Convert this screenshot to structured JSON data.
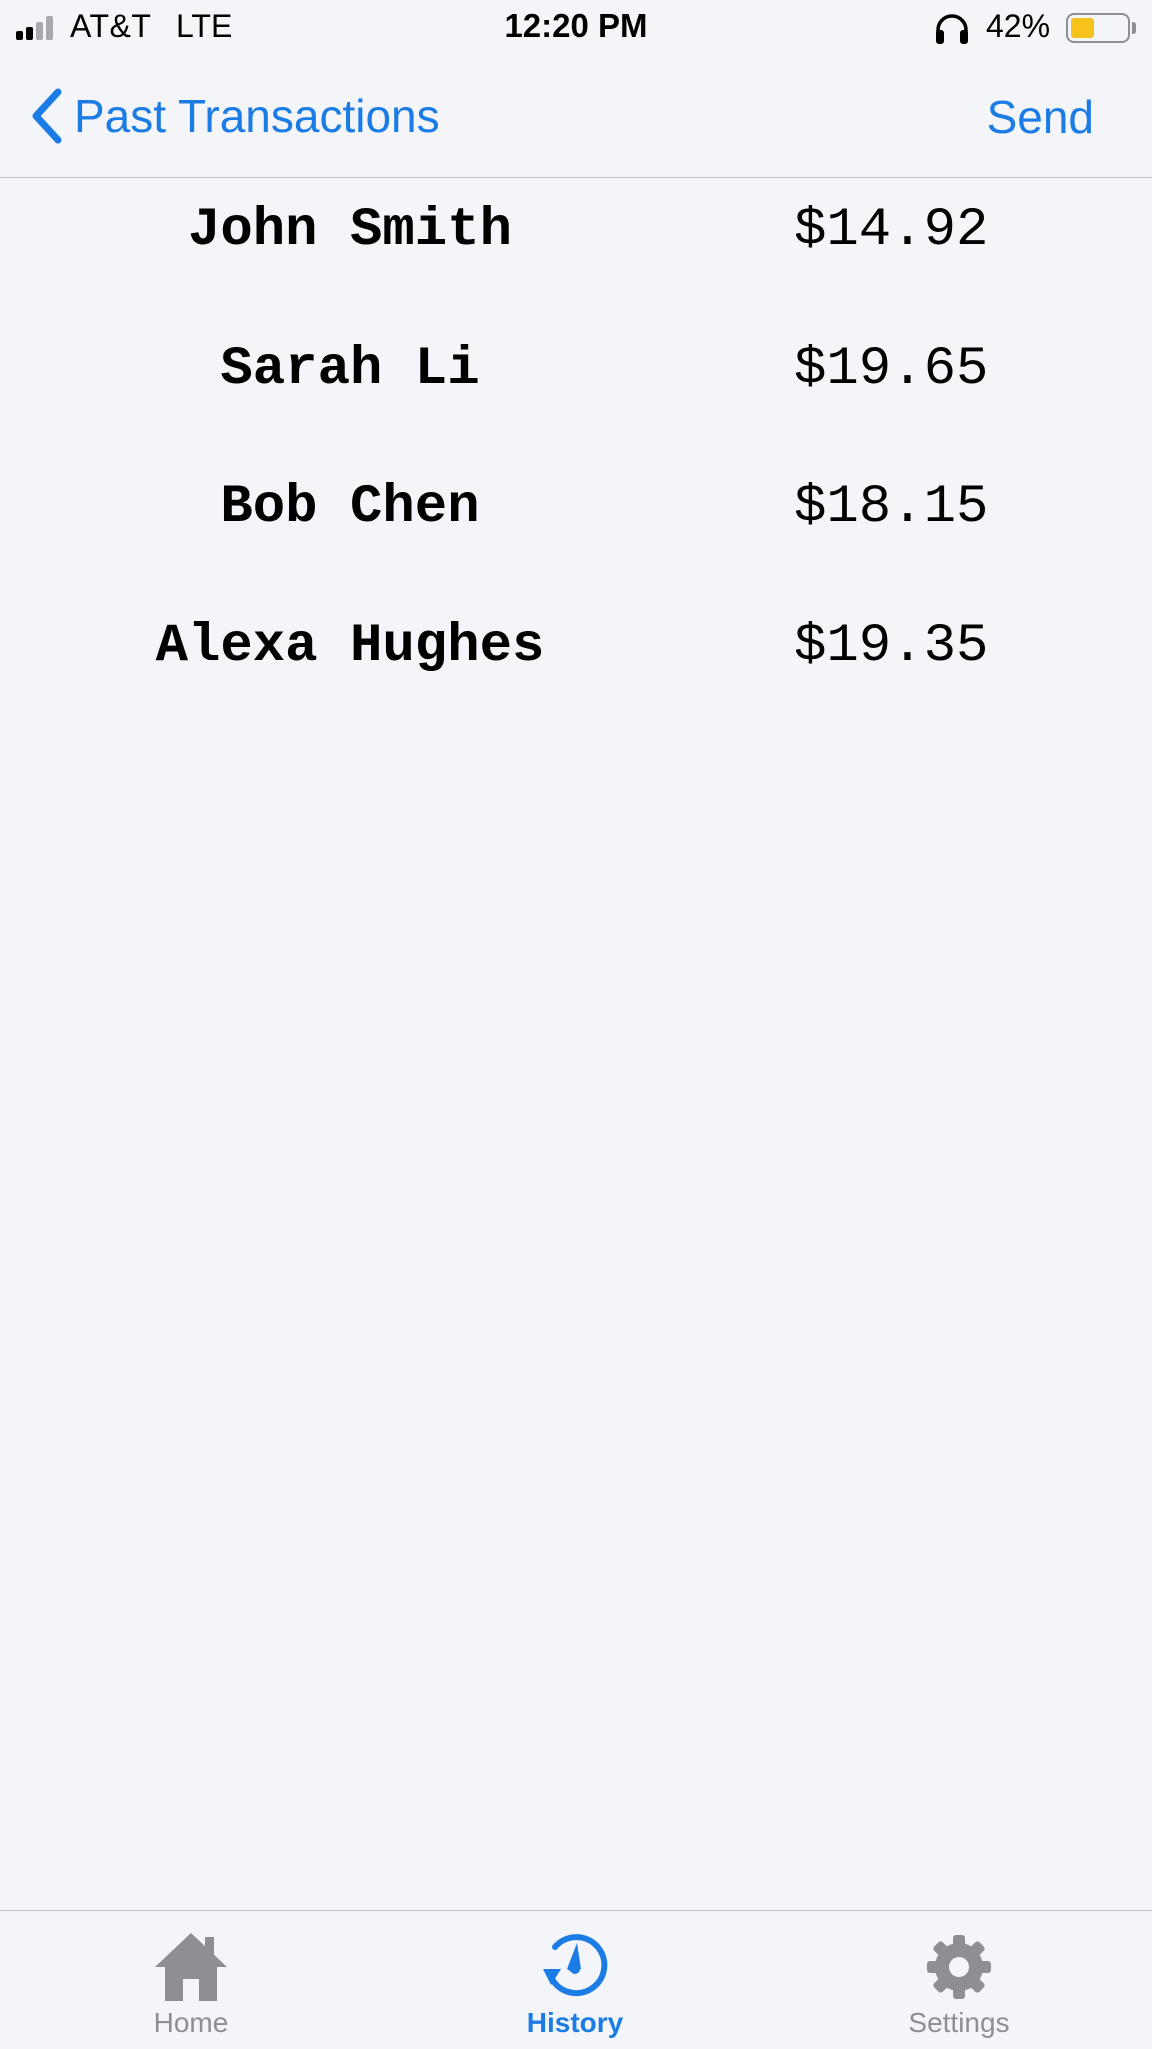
{
  "status_bar": {
    "carrier": "AT&T",
    "network": "LTE",
    "time": "12:20 PM",
    "battery_percent": "42%",
    "battery_level": 0.42,
    "signal_bars_active": 2,
    "signal_bars_total": 4,
    "icons": [
      "signal-icon",
      "headphones-icon",
      "battery-icon"
    ]
  },
  "nav": {
    "back_label": "Past Transactions",
    "action_label": "Send",
    "back_icon": "chevron-left-icon"
  },
  "transactions": [
    {
      "name": "John Smith",
      "amount": "$14.92"
    },
    {
      "name": "Sarah Li",
      "amount": "$19.65"
    },
    {
      "name": "Bob Chen",
      "amount": "$18.15"
    },
    {
      "name": "Alexa Hughes",
      "amount": "$19.35"
    }
  ],
  "tab_bar": {
    "tabs": [
      {
        "label": "Home",
        "icon": "home-icon",
        "selected": false
      },
      {
        "label": "History",
        "icon": "history-icon",
        "selected": true
      },
      {
        "label": "Settings",
        "icon": "gear-icon",
        "selected": false
      }
    ]
  },
  "colors": {
    "accent": "#1c7ce6",
    "inactive": "#8e8e93",
    "battery_fill": "#f7c31b",
    "background": "#f3f5f9",
    "text": "#000000"
  }
}
